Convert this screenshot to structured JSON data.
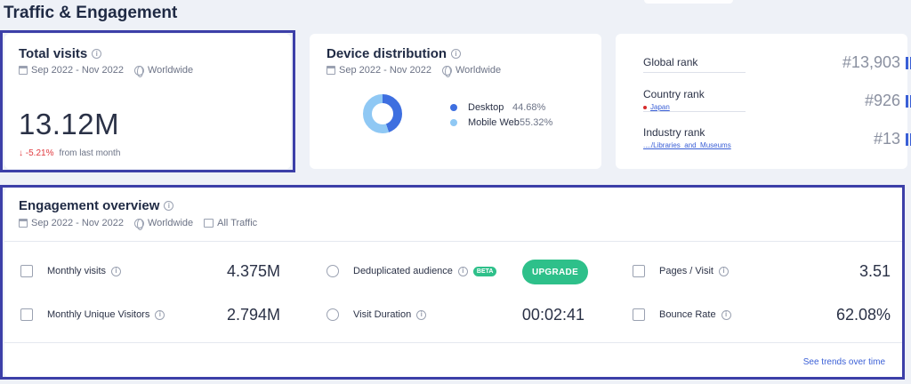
{
  "page": {
    "title": "Traffic & Engagement"
  },
  "total_visits": {
    "title": "Total visits",
    "date_range": "Sep 2022 - Nov 2022",
    "region": "Worldwide",
    "value": "13.12M",
    "change": "↓ -5.21%",
    "change_note": "from last month"
  },
  "device_distribution": {
    "title": "Device distribution",
    "date_range": "Sep 2022 - Nov 2022",
    "region": "Worldwide",
    "chart_data": {
      "type": "pie",
      "categories": [
        "Desktop",
        "Mobile Web"
      ],
      "values": [
        44.68,
        55.32
      ],
      "colors": [
        "#3e6fe0",
        "#8fc8f4"
      ]
    },
    "legend": [
      {
        "label": "Desktop",
        "value": "44.68%",
        "color": "#3e6fe0"
      },
      {
        "label": "Mobile Web",
        "value": "55.32%",
        "color": "#8fc8f4"
      }
    ]
  },
  "ranks": [
    {
      "label": "Global rank",
      "sub": "",
      "value": "#13,903"
    },
    {
      "label": "Country rank",
      "sub": "Japan",
      "value": "#926"
    },
    {
      "label": "Industry rank",
      "sub": "..../Libraries_and_Museums",
      "value": "#13"
    }
  ],
  "engagement": {
    "title": "Engagement overview",
    "date_range": "Sep 2022 - Nov 2022",
    "region": "Worldwide",
    "traffic": "All Traffic",
    "monthly_visits": {
      "label": "Monthly visits",
      "value": "4.375M"
    },
    "unique_visitors": {
      "label": "Monthly Unique Visitors",
      "value": "2.794M"
    },
    "dedup_audience": {
      "label": "Deduplicated audience",
      "badge": "BETA",
      "button": "UPGRADE"
    },
    "visit_duration": {
      "label": "Visit Duration",
      "value": "00:02:41"
    },
    "pages_per_visit": {
      "label": "Pages / Visit",
      "value": "3.51"
    },
    "bounce_rate": {
      "label": "Bounce Rate",
      "value": "62.08%"
    },
    "trends_link": "See trends over time"
  },
  "colors": {
    "accent": "#3a5fd6",
    "highlight_outline": "#3c3fa8",
    "upgrade": "#2ec08a",
    "negative": "#e0393e"
  }
}
